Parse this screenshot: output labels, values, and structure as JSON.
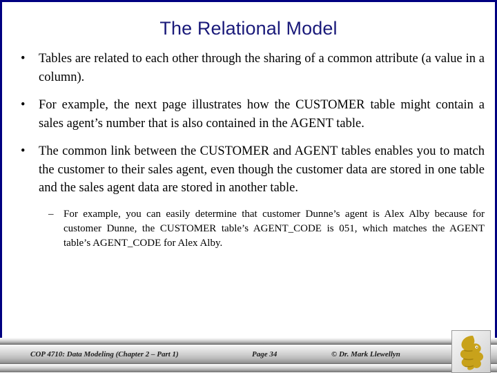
{
  "slide": {
    "title": "The Relational Model",
    "title_color": "#1a1a7a",
    "border_color": "#000080",
    "background_color": "#ffffff",
    "bullets": [
      {
        "marker": "•",
        "level": 1,
        "text": "Tables are related to each other through the sharing of a common attribute (a value in a column)."
      },
      {
        "marker": "•",
        "level": 1,
        "text": "For example, the next page illustrates how the CUSTOMER table might contain a sales agent’s number that is also contained in the AGENT table."
      },
      {
        "marker": "•",
        "level": 1,
        "text": "The common link between the CUSTOMER and AGENT tables enables you to match the customer to their sales agent, even though the customer data are stored in one table and the sales agent data are stored in another table."
      },
      {
        "marker": "–",
        "level": 2,
        "text": "For example, you can easily determine that customer Dunne’s agent is Alex Alby because for customer Dunne, the CUSTOMER table’s AGENT_CODE is 051, which matches the AGENT table’s AGENT_CODE for Alex Alby."
      }
    ]
  },
  "footer": {
    "course": "COP 4710: Data Modeling (Chapter 2 – Part 1)",
    "page": "Page 34",
    "credit": "© Dr. Mark Llewellyn",
    "logo_name": "ucf-pegasus-logo",
    "logo_color": "#C8A21B"
  }
}
